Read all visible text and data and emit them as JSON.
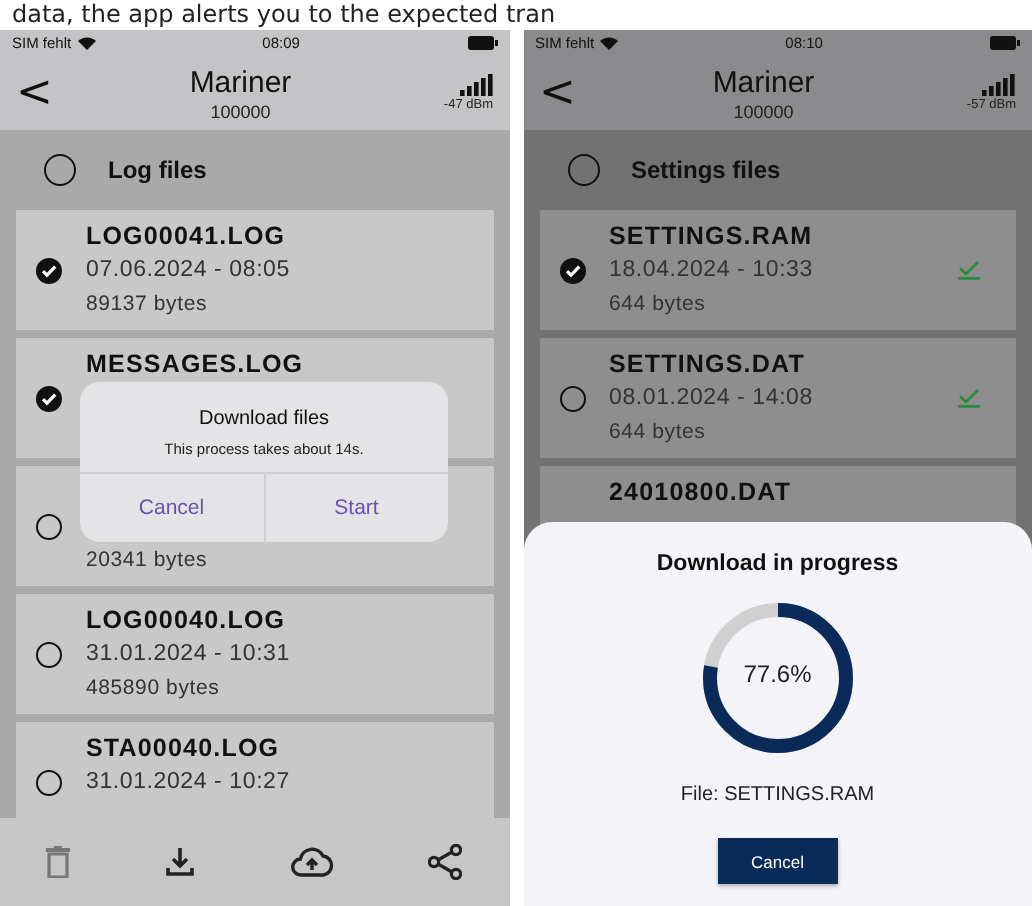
{
  "caption": "data, the app alerts you to the expected tran",
  "screens": [
    {
      "status": {
        "carrier": "SIM fehlt",
        "time": "08:09"
      },
      "header": {
        "back": "<",
        "title": "Mariner",
        "subtitle": "100000",
        "signal_reading": "-47 dBm"
      },
      "group": {
        "label": "Log files",
        "checked": false
      },
      "files": [
        {
          "name": "LOG00041.LOG",
          "date": "07.06.2024 - 08:05",
          "size": "89137 bytes",
          "checked": true
        },
        {
          "name": "MESSAGES.LOG",
          "checked": true
        },
        {
          "size": "20341 bytes",
          "checked": false
        },
        {
          "name": "LOG00040.LOG",
          "date": "31.01.2024 - 10:31",
          "size": "485890 bytes",
          "checked": false
        },
        {
          "name": "STA00040.LOG",
          "date": "31.01.2024 - 10:27",
          "checked": false
        }
      ],
      "toolbar": [
        {
          "kind": "delete",
          "disabled": true
        },
        {
          "kind": "download",
          "disabled": false
        },
        {
          "kind": "upload",
          "disabled": false
        },
        {
          "kind": "share",
          "disabled": false
        }
      ],
      "overlay": {
        "kind": "dialog",
        "title": "Download files",
        "message": "This process takes about 14s.",
        "buttons": [
          "Cancel",
          "Start"
        ]
      }
    },
    {
      "status": {
        "carrier": "SIM fehlt",
        "time": "08:10"
      },
      "header": {
        "back": "<",
        "title": "Mariner",
        "subtitle": "100000",
        "signal_reading": "-57 dBm"
      },
      "group": {
        "label": "Settings files",
        "checked": false
      },
      "files": [
        {
          "name": "SETTINGS.RAM",
          "date": "18.04.2024 - 10:33",
          "size": "644 bytes",
          "checked": true,
          "verified": true
        },
        {
          "name": "SETTINGS.DAT",
          "date": "08.01.2024 - 14:08",
          "size": "644 bytes",
          "checked": false,
          "verified": true
        },
        {
          "name": "24010800.DAT"
        }
      ],
      "overlay": {
        "kind": "sheet",
        "title": "Download in progress",
        "level": 0.776,
        "percent": "77.6%",
        "file": "File: SETTINGS.RAM",
        "buttons": [
          "Cancel"
        ]
      }
    }
  ]
}
